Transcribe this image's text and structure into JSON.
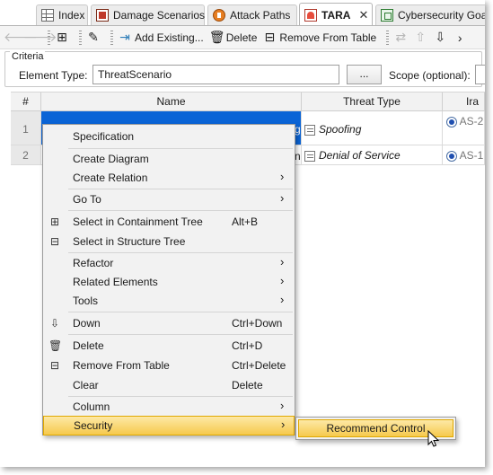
{
  "tabs": [
    {
      "label": "Index",
      "icon": "table-icon"
    },
    {
      "label": "Damage Scenarios",
      "icon": "damage-icon"
    },
    {
      "label": "Attack Paths",
      "icon": "attack-icon"
    },
    {
      "label": "TARA",
      "icon": "tara-icon",
      "close": "✕"
    },
    {
      "label": "Cybersecurity Goal",
      "icon": "goal-icon"
    }
  ],
  "toolbar": {
    "add_existing": "Add Existing...",
    "delete": "Delete",
    "remove_from_table": "Remove From Table"
  },
  "criteria": {
    "title": "Criteria",
    "element_type_label": "Element Type:",
    "element_type_value": "ThreatScenario",
    "browse_label": "...",
    "scope_label": "Scope (optional):"
  },
  "table": {
    "headers": {
      "num": "#",
      "name": "Name",
      "threat_type": "Threat Type",
      "impact": "Ira"
    },
    "rows": [
      {
        "num": "1",
        "name_tail": "g",
        "threat_type": "Spoofing",
        "impact": "AS-2"
      },
      {
        "num": "2",
        "name_tail": "n",
        "threat_type": "Denial of Service",
        "impact": "AS-1"
      }
    ]
  },
  "context_menu": {
    "items": [
      {
        "label": "Specification",
        "shortcut": "",
        "submenu": false
      },
      {
        "label": "Create Diagram",
        "shortcut": "",
        "submenu": false
      },
      {
        "label": "Create Relation",
        "shortcut": "",
        "submenu": true
      },
      {
        "label": "Go To",
        "shortcut": "",
        "submenu": true
      },
      {
        "label": "Select in Containment Tree",
        "shortcut": "Alt+B",
        "submenu": false
      },
      {
        "label": "Select in Structure Tree",
        "shortcut": "",
        "submenu": false
      },
      {
        "label": "Refactor",
        "shortcut": "",
        "submenu": true
      },
      {
        "label": "Related Elements",
        "shortcut": "",
        "submenu": true
      },
      {
        "label": "Tools",
        "shortcut": "",
        "submenu": true
      },
      {
        "label": "Down",
        "shortcut": "Ctrl+Down",
        "submenu": false
      },
      {
        "label": "Delete",
        "shortcut": "Ctrl+D",
        "submenu": false
      },
      {
        "label": "Remove From Table",
        "shortcut": "Ctrl+Delete",
        "submenu": false
      },
      {
        "label": "Clear",
        "shortcut": "Delete",
        "submenu": false
      },
      {
        "label": "Column",
        "shortcut": "",
        "submenu": true
      },
      {
        "label": "Security",
        "shortcut": "",
        "submenu": true
      }
    ],
    "arrow": "›",
    "highlighted": "Security"
  },
  "submenu": {
    "recommend_control": "Recommend Control"
  },
  "colors": {
    "highlight": "#f6c94d",
    "selection": "#0a64d6",
    "radio": "#1f4fb0"
  }
}
